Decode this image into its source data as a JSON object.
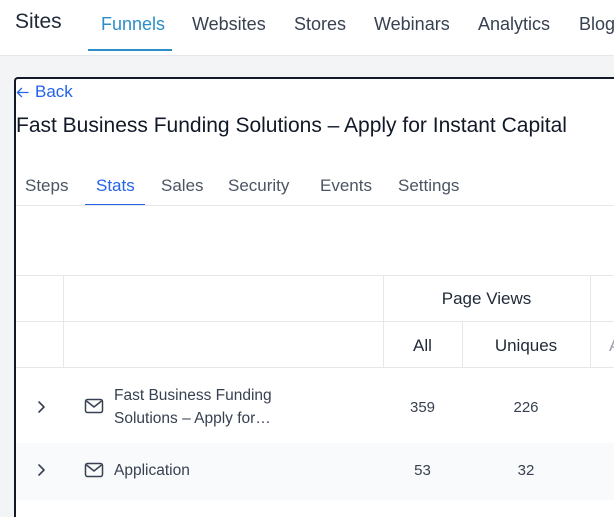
{
  "topnav": {
    "brand": "Sites",
    "items": [
      {
        "label": "Funnels",
        "active": true
      },
      {
        "label": "Websites",
        "active": false
      },
      {
        "label": "Stores",
        "active": false
      },
      {
        "label": "Webinars",
        "active": false
      },
      {
        "label": "Analytics",
        "active": false
      },
      {
        "label": "Blog",
        "active": false
      }
    ]
  },
  "back_label": "Back",
  "funnel_title": "Fast Business Funding Solutions – Apply for Instant Capital",
  "tabs": [
    {
      "label": "Steps",
      "active": false
    },
    {
      "label": "Stats",
      "active": true
    },
    {
      "label": "Sales",
      "active": false
    },
    {
      "label": "Security",
      "active": false
    },
    {
      "label": "Events",
      "active": false
    },
    {
      "label": "Settings",
      "active": false
    }
  ],
  "table": {
    "group_header": "Page Views",
    "columns": [
      "All",
      "Uniques"
    ],
    "rows": [
      {
        "name": "Fast Business Funding Solutions – Apply for…",
        "all": "359",
        "uniques": "226"
      },
      {
        "name": "Application",
        "all": "53",
        "uniques": "32"
      }
    ]
  },
  "colors": {
    "accent": "#2b8ec9",
    "link": "#2563eb",
    "border": "#111827"
  },
  "icons": {
    "back": "arrow-left-icon",
    "expand": "chevron-right-icon",
    "step": "mail-icon"
  }
}
